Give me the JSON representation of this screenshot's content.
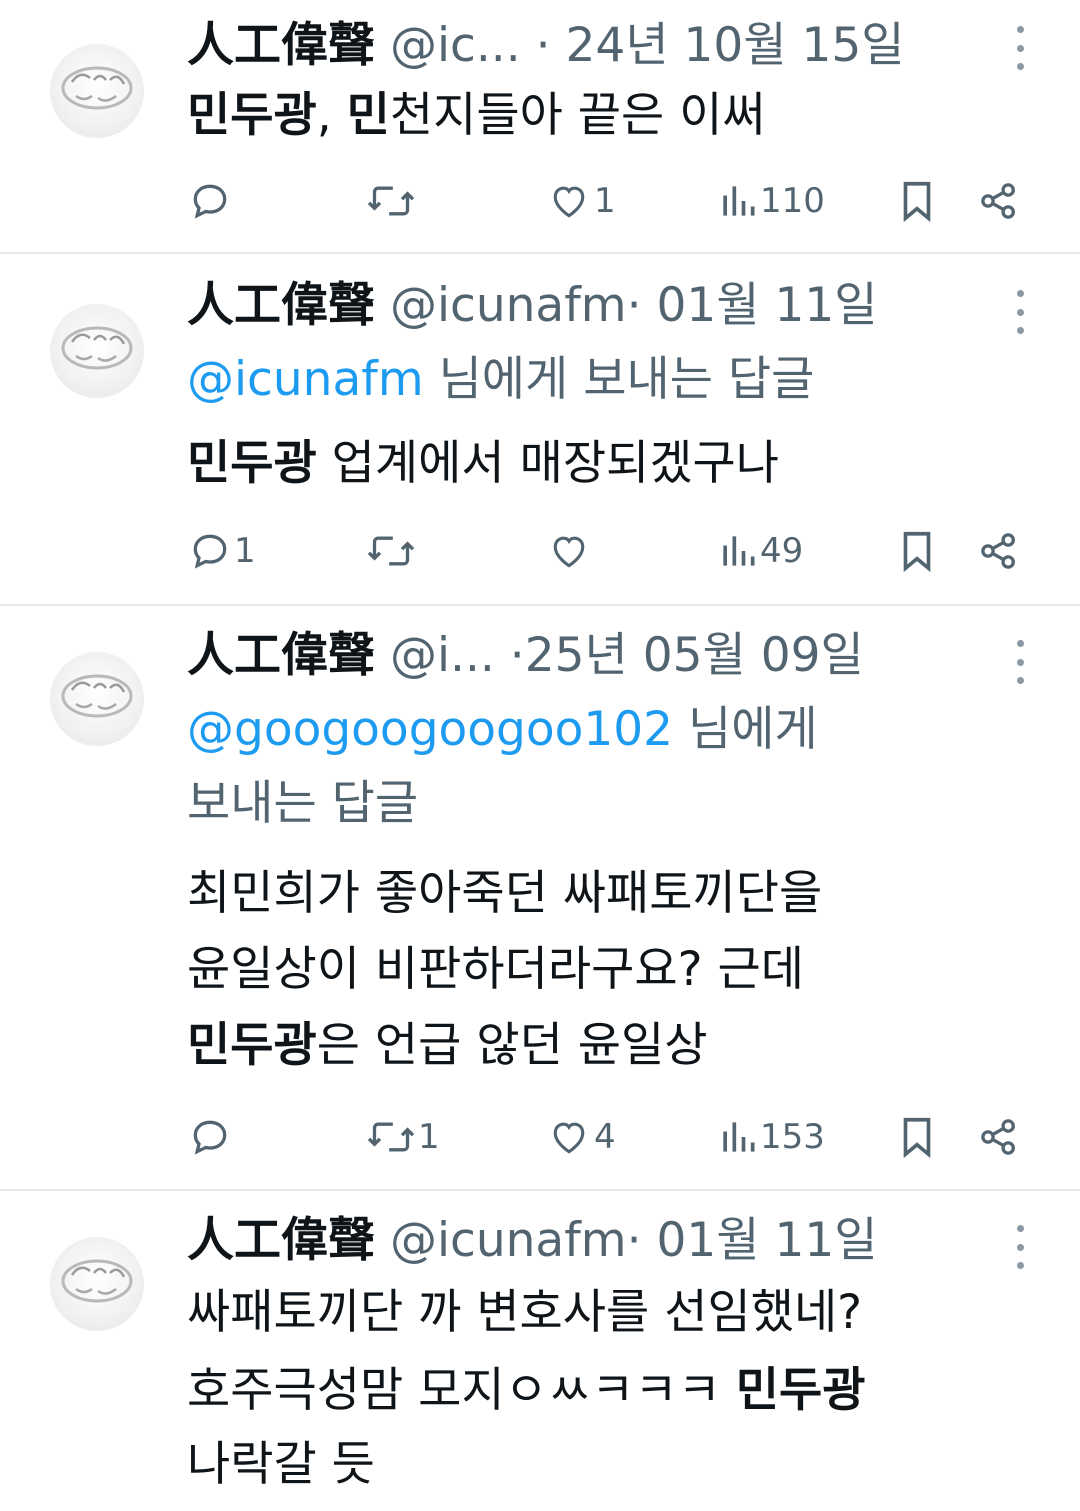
{
  "tweets": [
    {
      "name": "人工偉聲",
      "handle": "@ic...",
      "separator": "·",
      "date": "24년 10월 15일",
      "reply_to": null,
      "lines": [
        [
          {
            "t": "민두광",
            "b": true
          },
          {
            "t": ", ",
            "b": false
          },
          {
            "t": "민",
            "b": true
          },
          {
            "t": "천지들아 끝은 이써",
            "b": false
          }
        ]
      ],
      "stats": {
        "replies": "",
        "retweets": "",
        "likes": "1",
        "views": "110"
      }
    },
    {
      "name": "人工偉聲",
      "handle": "@icunafm",
      "separator": "·",
      "date": "01월 11일",
      "reply_to": {
        "mention": "@icunafm",
        "text": "님에게 보내는 답글"
      },
      "lines": [
        [
          {
            "t": "민두광",
            "b": true
          },
          {
            "t": " 업계에서 매장되겠구나",
            "b": false
          }
        ]
      ],
      "stats": {
        "replies": "1",
        "retweets": "",
        "likes": "",
        "views": "49"
      }
    },
    {
      "name": "人工偉聲",
      "handle": "@i...",
      "separator": "·",
      "date": "25년 05월 09일",
      "reply_to": {
        "mention": "@googoogoogoo102",
        "text": "님에게",
        "text2": "보내는 답글"
      },
      "lines": [
        [
          {
            "t": "최민희가 좋아죽던 싸패토끼단을",
            "b": false
          }
        ],
        [
          {
            "t": "윤일상이 비판하더라구요? 근데",
            "b": false
          }
        ],
        [
          {
            "t": "민두광",
            "b": true
          },
          {
            "t": "은 언급 않던 윤일상",
            "b": false
          }
        ]
      ],
      "stats": {
        "replies": "",
        "retweets": "1",
        "likes": "4",
        "views": "153"
      }
    },
    {
      "name": "人工偉聲",
      "handle": "@icunafm",
      "separator": "·",
      "date": "01월 11일",
      "reply_to": null,
      "lines": [
        [
          {
            "t": "싸패토끼단 까 변호사를 선임했네?",
            "b": false
          }
        ],
        [
          {
            "t": "호주극성맘 모지ㅇㅆㅋㅋㅋ ",
            "b": false
          },
          {
            "t": "민두광",
            "b": true
          }
        ],
        [
          {
            "t": "나락갈 듯",
            "b": false
          }
        ]
      ],
      "stats": null
    }
  ],
  "icons": {
    "reply": "reply-icon",
    "retweet": "retweet-icon",
    "like": "heart-icon",
    "views": "views-chart-icon",
    "bookmark": "bookmark-icon",
    "share": "share-icon",
    "more": "more-vertical-icon"
  },
  "colors": {
    "text": "#0f1419",
    "secondary": "#536471",
    "link": "#1d9bf0",
    "divider": "#e6e9ec"
  }
}
